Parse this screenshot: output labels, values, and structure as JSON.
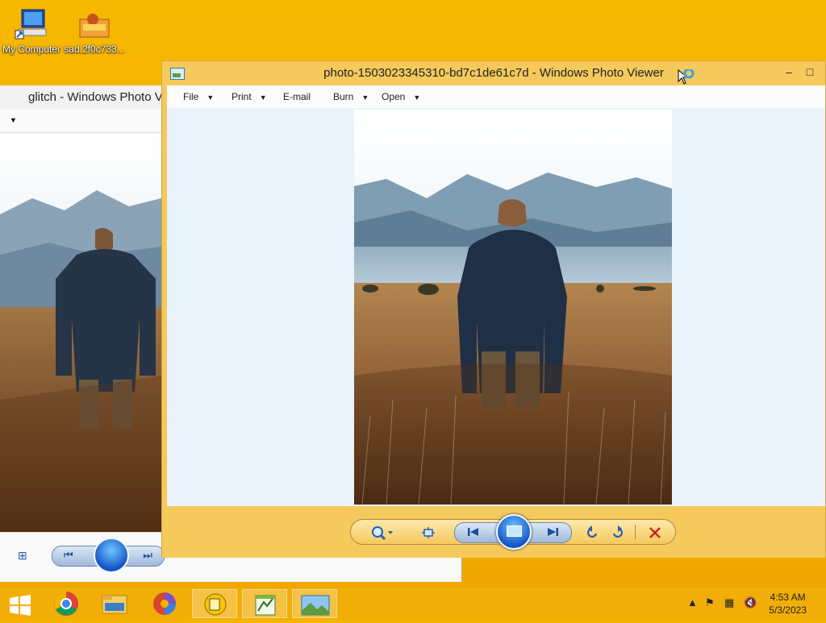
{
  "desktop": {
    "icons": [
      {
        "label": "My Computer"
      },
      {
        "label": "sad.2f0c733..."
      }
    ]
  },
  "background_window": {
    "title": "glitch - Windows Photo V"
  },
  "main_window": {
    "title": "photo-1503023345310-bd7c1de61c7d - Windows Photo Viewer",
    "menu": [
      {
        "label": "File",
        "has_arrow": true
      },
      {
        "label": "Print",
        "has_arrow": true
      },
      {
        "label": "E-mail",
        "has_arrow": false
      },
      {
        "label": "Burn",
        "has_arrow": true
      },
      {
        "label": "Open",
        "has_arrow": true
      }
    ],
    "min_symbol": "–",
    "max_symbol": "□"
  },
  "controls": {
    "zoom_icon": "magnifier-icon",
    "actual_size_icon": "actual-size-icon",
    "prev_icon": "previous-icon",
    "slideshow_icon": "slideshow-icon",
    "next_icon": "next-icon",
    "rotate_ccw_icon": "rotate-ccw-icon",
    "rotate_cw_icon": "rotate-cw-icon",
    "delete_icon": "delete-icon",
    "delete_color": "#d1221a"
  },
  "taskbar": {
    "apps": [
      "start",
      "chrome",
      "file-explorer",
      "media-app",
      "file-manager",
      "notepad-app",
      "photo-viewer"
    ],
    "clock_time": "4:53 AM",
    "clock_date": "5/3/2023"
  },
  "colors": {
    "desktop": "#f6b500",
    "window_frame": "#f5c95c",
    "viewer_bg": "#e9f3fb"
  }
}
